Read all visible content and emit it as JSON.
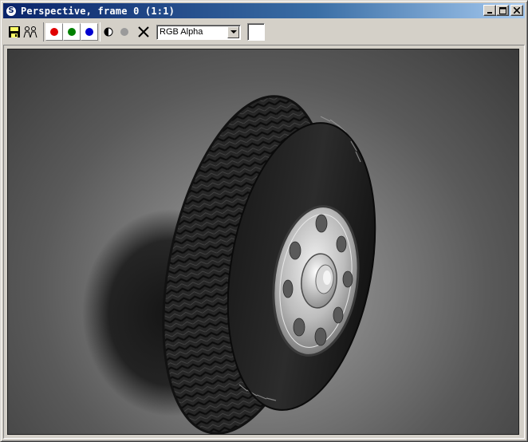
{
  "window": {
    "title": "Perspective, frame 0 (1:1)",
    "app_icon": "3ds-max-logo-icon",
    "controls": [
      "minimize-icon",
      "maximize-icon",
      "close-icon"
    ]
  },
  "toolbar": {
    "tools": [
      "save-icon",
      "clone-icon"
    ],
    "channels": [
      {
        "name": "red-channel-icon",
        "color": "#e00000"
      },
      {
        "name": "green-channel-icon",
        "color": "#008000"
      },
      {
        "name": "blue-channel-icon",
        "color": "#0000d0"
      }
    ],
    "extra_tools": [
      "monochrome-icon",
      "alpha-dot-icon",
      "clear-icon"
    ],
    "channel_select": {
      "value": "RGB Alpha"
    },
    "swatch_color": "#ffffff"
  },
  "render": {
    "subject": "tire-render-image"
  }
}
